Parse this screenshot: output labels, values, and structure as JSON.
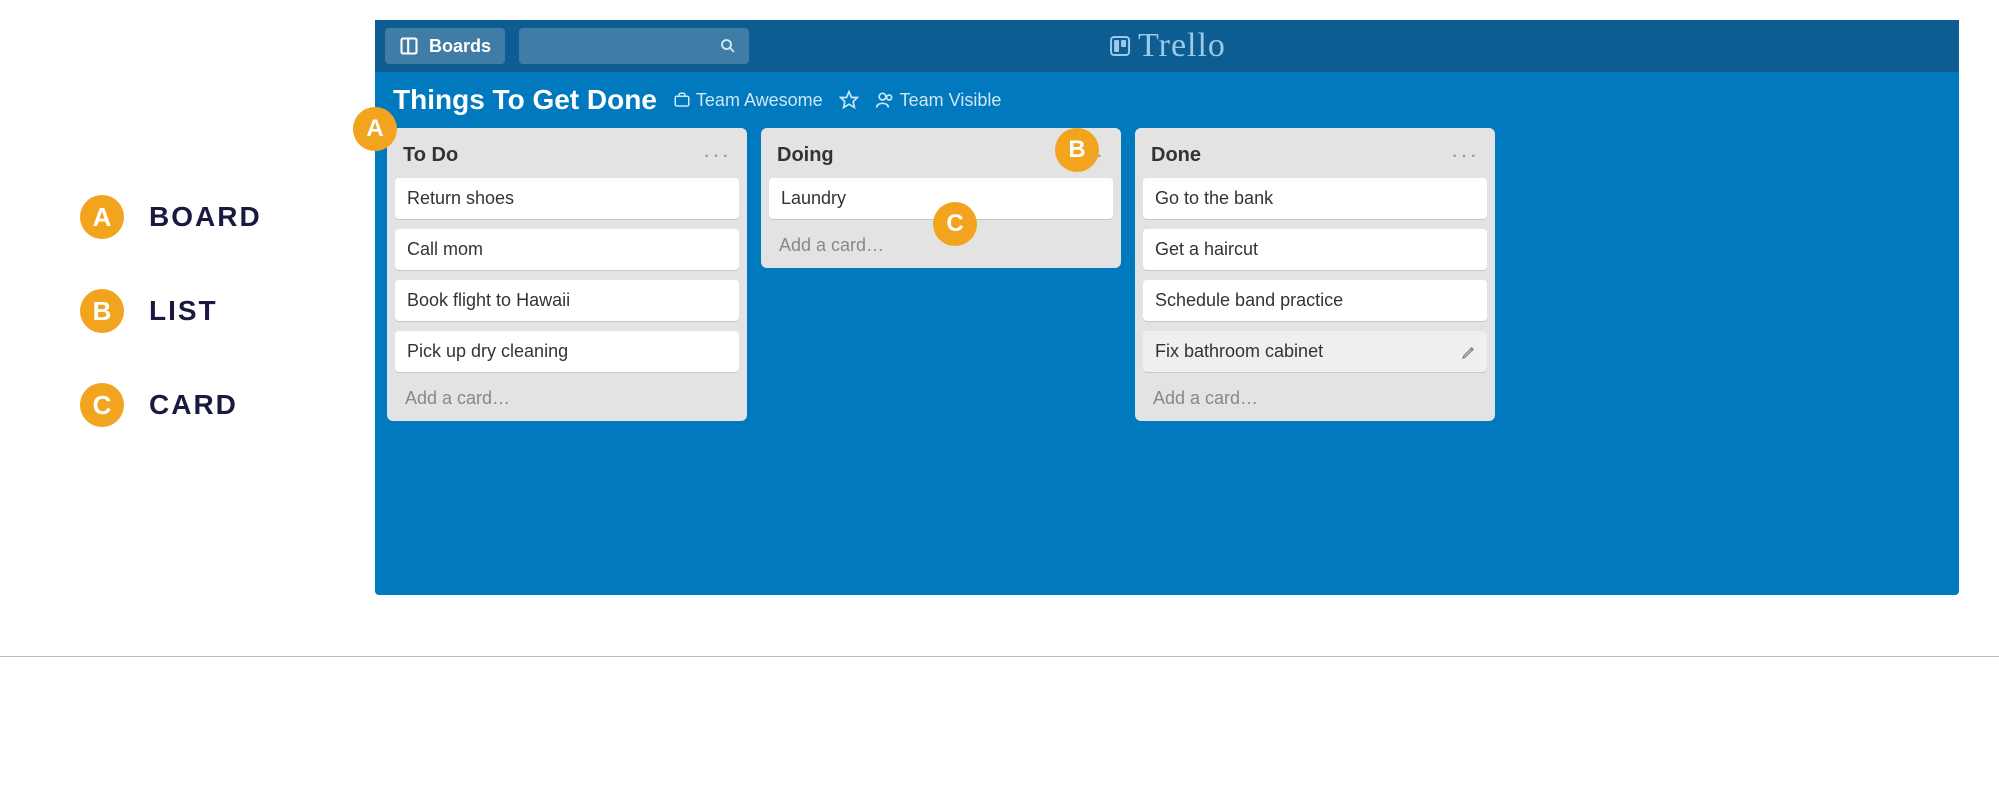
{
  "legend": {
    "a": {
      "badge": "A",
      "label": "BOARD"
    },
    "b": {
      "badge": "B",
      "label": "LIST"
    },
    "c": {
      "badge": "C",
      "label": "CARD"
    }
  },
  "overlay": {
    "a": "A",
    "b": "B",
    "c": "C"
  },
  "topbar": {
    "boards_label": "Boards",
    "brand": "Trello"
  },
  "board": {
    "title": "Things To Get Done",
    "team": "Team Awesome",
    "visibility": "Team Visible"
  },
  "lists": {
    "todo": {
      "title": "To Do",
      "cards": [
        "Return shoes",
        "Call mom",
        "Book flight to Hawaii",
        "Pick up dry cleaning"
      ],
      "add_label": "Add a card…"
    },
    "doing": {
      "title": "Doing",
      "cards": [
        "Laundry"
      ],
      "add_label": "Add a card…"
    },
    "done": {
      "title": "Done",
      "cards": [
        "Go to the bank",
        "Get a haircut",
        "Schedule band practice",
        "Fix bathroom cabinet"
      ],
      "add_label": "Add a card…"
    }
  }
}
